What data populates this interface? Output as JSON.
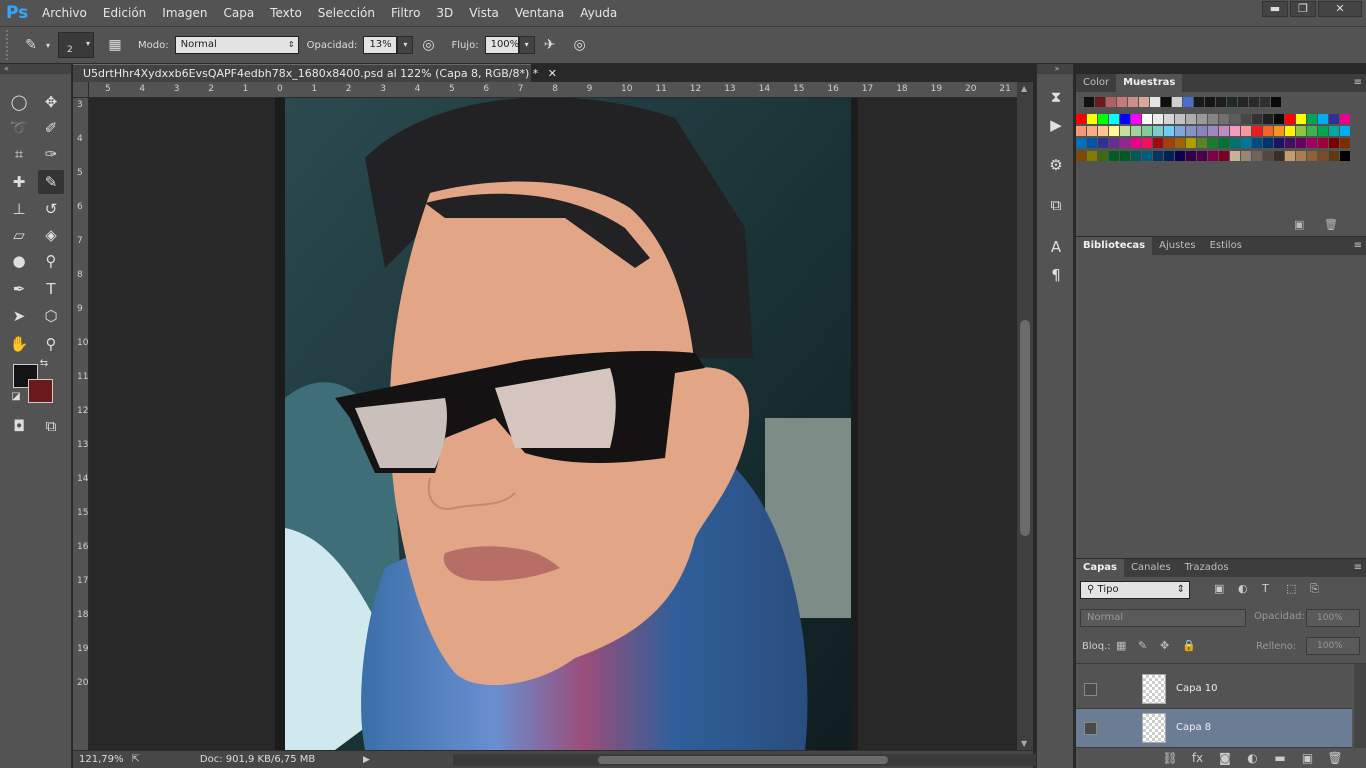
{
  "app": {
    "logo": "Ps"
  },
  "menu": [
    "Archivo",
    "Edición",
    "Imagen",
    "Capa",
    "Texto",
    "Selección",
    "Filtro",
    "3D",
    "Vista",
    "Ventana",
    "Ayuda"
  ],
  "window_controls": {
    "minimize": "▬",
    "restore": "❐",
    "close": "✕"
  },
  "options": {
    "brush_size": "2",
    "mode_label": "Modo:",
    "mode_value": "Normal",
    "opacity_label": "Opacidad:",
    "opacity_value": "13%",
    "flow_label": "Flujo:",
    "flow_value": "100%"
  },
  "document": {
    "tab_title": "U5drtHhr4Xydxxb6EvsQAPF4edbh78x_1680x8400.psd al 122% (Capa 8, RGB/8*) *",
    "close": "✕"
  },
  "ruler_h": [
    "5",
    "4",
    "3",
    "2",
    "1",
    "0",
    "1",
    "2",
    "3",
    "4",
    "5",
    "6",
    "7",
    "8",
    "9",
    "10",
    "11",
    "12",
    "13",
    "14",
    "15",
    "16",
    "17",
    "18",
    "19",
    "20",
    "21"
  ],
  "ruler_v": [
    "3",
    "4",
    "5",
    "6",
    "7",
    "8",
    "9",
    "10",
    "11",
    "12",
    "13",
    "14",
    "15",
    "16",
    "17",
    "18",
    "19",
    "20"
  ],
  "status": {
    "zoom": "121,79%",
    "doc": "Doc: 901,9 KB/6,75 MB"
  },
  "color_panel": {
    "tabs": [
      "Color",
      "Muestras"
    ],
    "active_tab": "Muestras",
    "recent": [
      "#111111",
      "#6b1a1c",
      "#b06063",
      "#c87a78",
      "#c9908a",
      "#d9a898",
      "#e5e5e5",
      "#0e0e0e",
      "#d0d0d0",
      "#4a6fd0",
      "#1a1a1a",
      "#151515",
      "#1d1d1d",
      "#202a2a",
      "#252525",
      "#2a2a2a",
      "#303030",
      "#0a0a0a"
    ],
    "grid": [
      [
        "#ff0000",
        "#ffff00",
        "#00ff00",
        "#00ffff",
        "#0000ff",
        "#ff00ff",
        "#ffffff",
        "#ebebeb",
        "#d6d6d6",
        "#c2c2c2",
        "#adadad",
        "#999999",
        "#858585",
        "#707070",
        "#5c5c5c",
        "#474747",
        "#333333",
        "#1f1f1f",
        "#0a0a0a",
        "#ff0000",
        "#ffff00",
        "#00a651",
        "#00aeef",
        "#2e3192",
        "#ec008c"
      ],
      [
        "#f7977a",
        "#f9ad81",
        "#fdc68a",
        "#fff79a",
        "#c4df9b",
        "#a2d39c",
        "#82ca9d",
        "#7bcdc8",
        "#6ecff6",
        "#7ea7d8",
        "#8493ca",
        "#8882be",
        "#a187be",
        "#bc8dbf",
        "#f49ac2",
        "#f6989d",
        "#ed1c24",
        "#f26522",
        "#f7941d",
        "#fff200",
        "#8dc73f",
        "#39b54a",
        "#00a651",
        "#00a99d",
        "#00aeef"
      ],
      [
        "#0072bc",
        "#0054a6",
        "#2e3192",
        "#662d91",
        "#92278f",
        "#ec008c",
        "#ed145b",
        "#9e0b0f",
        "#a0410d",
        "#a36209",
        "#aba000",
        "#598527",
        "#197b30",
        "#007236",
        "#00746b",
        "#0076a3",
        "#004b80",
        "#003471",
        "#1b1464",
        "#440e62",
        "#630460",
        "#9e005d",
        "#9e0039",
        "#790000",
        "#7b2e00"
      ],
      [
        "#7d4900",
        "#827b00",
        "#406618",
        "#005e20",
        "#005826",
        "#005952",
        "#005b7f",
        "#003663",
        "#002157",
        "#0d004c",
        "#32004b",
        "#4b0049",
        "#7b0046",
        "#7a0026",
        "#c7b299",
        "#998675",
        "#736357",
        "#534741",
        "#37302a",
        "#c69c6d",
        "#a67c52",
        "#8c6239",
        "#754c24",
        "#603913",
        "#000000"
      ]
    ]
  },
  "lib_panel": {
    "tabs": [
      "Bibliotecas",
      "Ajustes",
      "Estilos"
    ],
    "active_tab": "Bibliotecas"
  },
  "layers_panel": {
    "tabs": [
      "Capas",
      "Canales",
      "Trazados"
    ],
    "active_tab": "Capas",
    "filter": "Tipo",
    "blend": "Normal",
    "opacity_label": "Opacidad:",
    "opacity_value": "100%",
    "lock_label": "Bloq.:",
    "fill_label": "Relleno:",
    "fill_value": "100%",
    "layers": [
      {
        "name": "Capa 10",
        "selected": false
      },
      {
        "name": "Capa 8",
        "selected": true
      }
    ]
  },
  "colors": {
    "foreground": "#141414",
    "background": "#6b1a1c",
    "accent": "#31a8ff",
    "selected_layer": "#6b7c95"
  }
}
